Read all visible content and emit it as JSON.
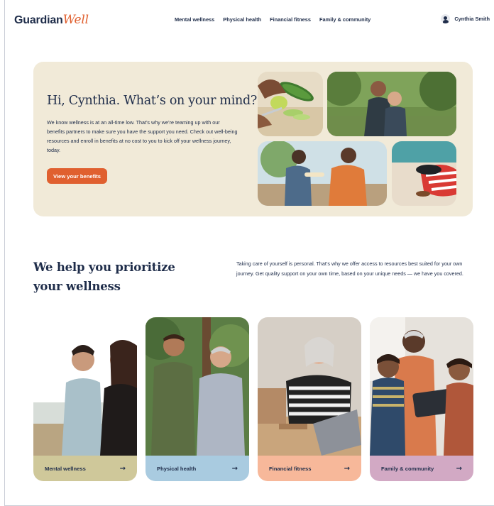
{
  "brand": {
    "name_main": "Guardian",
    "name_accent": "Well",
    "accent_color": "#e0602f"
  },
  "nav": {
    "items": [
      {
        "label": "Mental wellness"
      },
      {
        "label": "Physical health"
      },
      {
        "label": "Financial fitness"
      },
      {
        "label": "Family & community"
      }
    ]
  },
  "user": {
    "name": "Cynthia Smith",
    "icon": "user-icon"
  },
  "hero": {
    "title": "Hi, Cynthia. What’s on your mind?",
    "body": "We know wellness is at an all-time low. That’s why we’re teaming up with our benefits partners to make sure you have the support you need. Check out well-being resources and enroll in benefits at no cost to you to kick off your wellness journey, today.",
    "cta": "View your benefits",
    "background_color": "#f1ead8"
  },
  "section": {
    "title": "We help you prioritize your wellness",
    "description": "Taking care of yourself is personal. That’s why we offer access to resources best suited for your own journey. Get quality support on your own time, based on your unique needs — we have you covered."
  },
  "cards": [
    {
      "label": "Mental wellness",
      "color": "#cfc89a",
      "arrow": "→"
    },
    {
      "label": "Physical health",
      "color": "#a9cbe0",
      "arrow": "→"
    },
    {
      "label": "Financial fitness",
      "color": "#f7b89a",
      "arrow": "→"
    },
    {
      "label": "Family & community",
      "color": "#d2a9c4",
      "arrow": "→"
    }
  ]
}
